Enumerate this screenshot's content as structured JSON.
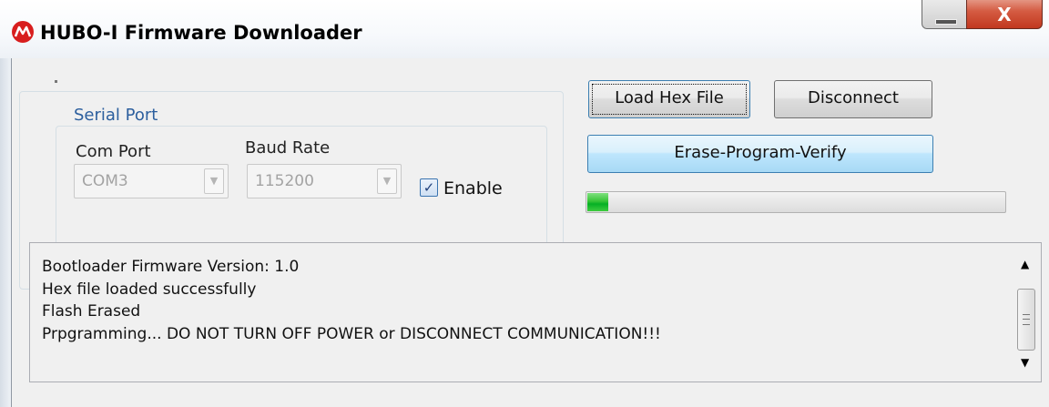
{
  "window": {
    "title": "HUBO-I Firmware Downloader",
    "close_glyph": "X"
  },
  "serial": {
    "legend": "Serial Port",
    "com_port_label": "Com Port",
    "com_port_value": "COM3",
    "baud_rate_label": "Baud Rate",
    "baud_rate_value": "115200",
    "enable_label": "Enable",
    "enable_checked": true
  },
  "buttons": {
    "load_hex": "Load Hex File",
    "disconnect": "Disconnect",
    "erase_program_verify": "Erase-Program-Verify"
  },
  "progress": {
    "percent": 5,
    "color": "#06b025"
  },
  "log": {
    "lines": [
      "Bootloader Firmware Version: 1.0",
      "Hex file loaded successfully",
      "Flash Erased",
      "Prpgramming... DO NOT TURN OFF POWER or DISCONNECT COMMUNICATION!!!"
    ]
  },
  "icons": {
    "app": "microchip-logo-icon",
    "minimize": "minimize-icon",
    "close": "close-icon",
    "dropdown": "chevron-down-icon",
    "scroll_up": "scroll-up-arrow-icon",
    "scroll_down": "scroll-down-arrow-icon"
  },
  "colors": {
    "close_button": "#c2381f",
    "legend_text": "#2c5f9e",
    "focus_border": "#3c7fb1"
  }
}
